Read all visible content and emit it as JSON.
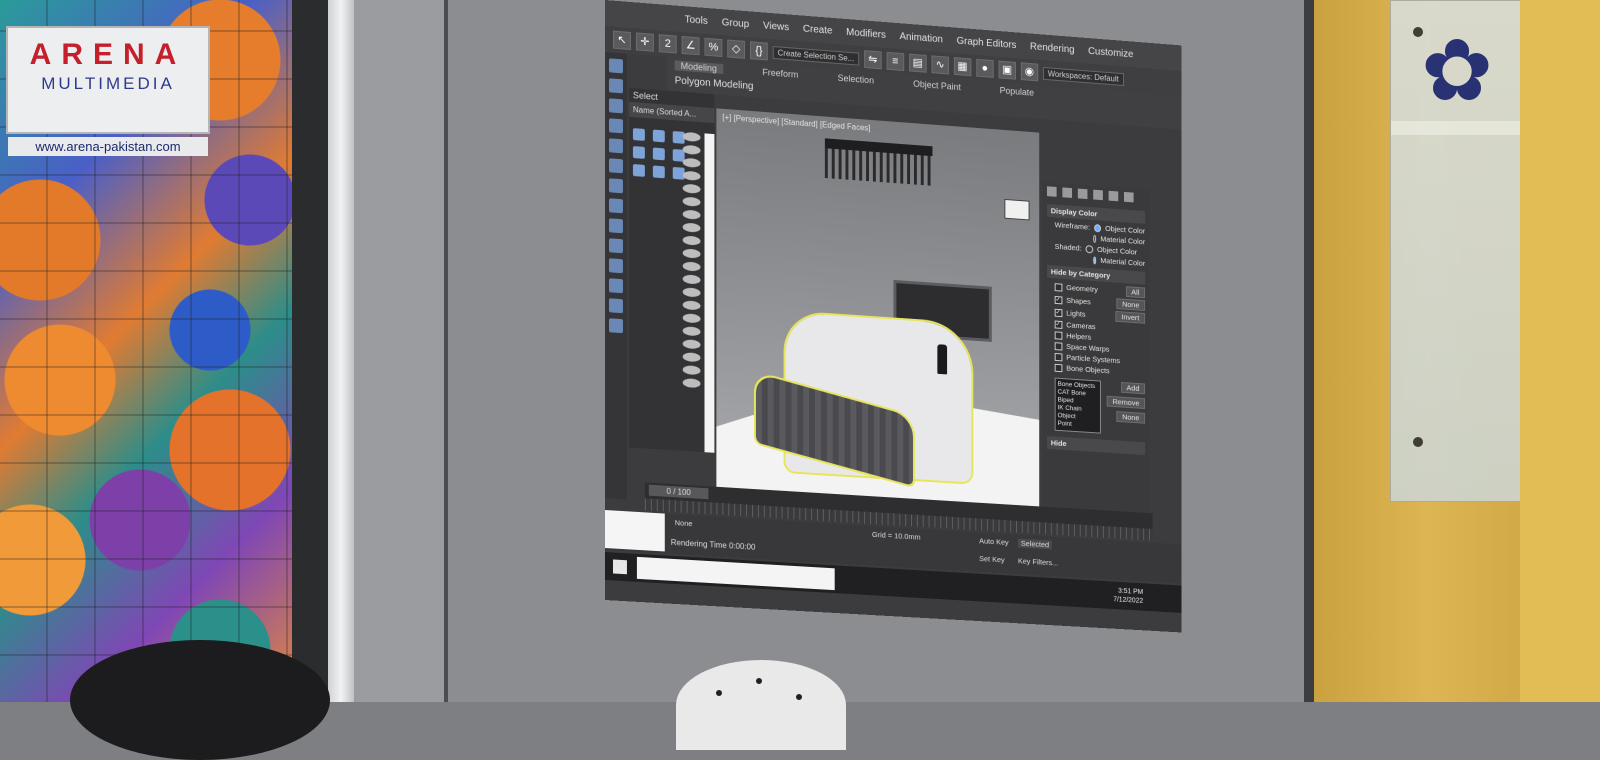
{
  "banner": {
    "logo_line1": "ARENA",
    "logo_line2": "MULTIMEDIA",
    "url": "www.arena-pakistan.com"
  },
  "app": {
    "menu": [
      "Tools",
      "Group",
      "Views",
      "Create",
      "Modifiers",
      "Animation",
      "Graph Editors",
      "Rendering",
      "Customize"
    ],
    "workspace_label": "Workspaces: Default",
    "selection_set_placeholder": "Create Selection Se...",
    "ribbon_tabs": [
      "Modeling",
      "Freeform",
      "Selection",
      "Object Paint",
      "Populate"
    ],
    "ribbon_subtitle": "Polygon Modeling",
    "scene_explorer": {
      "select_label": "Select",
      "column_header": "Name (Sorted A..."
    },
    "viewport_label": "[+] [Perspective] [Standard] [Edged Faces]",
    "command_panel": {
      "display_color": {
        "title": "Display Color",
        "wireframe_label": "Wireframe:",
        "shaded_label": "Shaded:",
        "options": [
          "Object Color",
          "Material Color"
        ]
      },
      "hide_by_category": {
        "title": "Hide by Category",
        "items": [
          {
            "label": "Geometry",
            "checked": false
          },
          {
            "label": "Shapes",
            "checked": true
          },
          {
            "label": "Lights",
            "checked": true
          },
          {
            "label": "Cameras",
            "checked": true
          },
          {
            "label": "Helpers",
            "checked": false
          },
          {
            "label": "Space Warps",
            "checked": false
          },
          {
            "label": "Particle Systems",
            "checked": false
          },
          {
            "label": "Bone Objects",
            "checked": false
          }
        ],
        "buttons": [
          "All",
          "None",
          "Invert"
        ],
        "list": [
          "Bone Objects",
          "CAT Bone",
          "Biped",
          "IK Chain Object",
          "Point"
        ],
        "list_buttons": [
          "Add",
          "Remove",
          "None"
        ]
      },
      "hide_title": "Hide"
    },
    "timeline": {
      "frame": "0 / 100"
    },
    "status": {
      "selection": "None",
      "rendering_time": "Rendering Time 0:00:00",
      "grid": "Grid = 10.0mm",
      "auto_key": "Auto Key",
      "selected": "Selected",
      "set_key": "Set Key",
      "key_filters": "Key Filters..."
    },
    "taskbar": {
      "time": "3:51 PM",
      "date": "7/12/2022"
    }
  },
  "colors": {
    "selection_outline": "#e7e55b",
    "ui_bg": "#3c3c3e",
    "logo_red": "#c41f2a",
    "logo_blue": "#2e3b8c"
  }
}
